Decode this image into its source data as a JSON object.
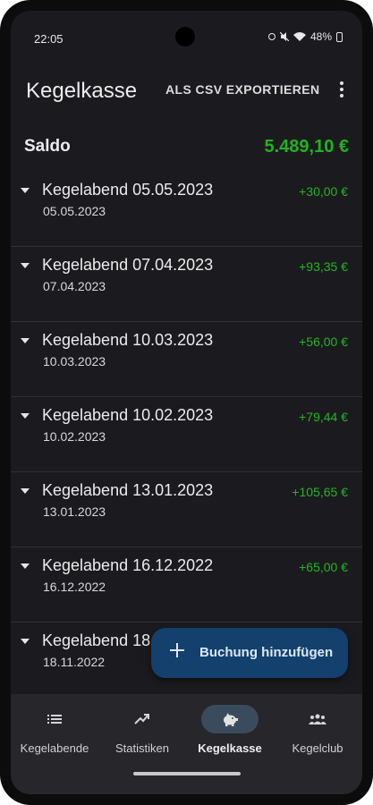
{
  "status_bar": {
    "time": "22:05",
    "battery": "48%"
  },
  "app_bar": {
    "title": "Kegelkasse",
    "export_label": "ALS CSV EXPORTIEREN",
    "more_icon": "more-vert-icon"
  },
  "balance": {
    "label": "Saldo",
    "value": "5.489,10 €"
  },
  "entries": [
    {
      "title": "Kegelabend 05.05.2023",
      "date": "05.05.2023",
      "amount": "+30,00 €"
    },
    {
      "title": "Kegelabend 07.04.2023",
      "date": "07.04.2023",
      "amount": "+93,35 €"
    },
    {
      "title": "Kegelabend 10.03.2023",
      "date": "10.03.2023",
      "amount": "+56,00 €"
    },
    {
      "title": "Kegelabend 10.02.2023",
      "date": "10.02.2023",
      "amount": "+79,44 €"
    },
    {
      "title": "Kegelabend 13.01.2023",
      "date": "13.01.2023",
      "amount": "+105,65 €"
    },
    {
      "title": "Kegelabend 16.12.2022",
      "date": "16.12.2022",
      "amount": "+65,00 €"
    },
    {
      "title": "Kegelabend 18.",
      "date": "18.11.2022",
      "amount": ""
    }
  ],
  "fab": {
    "label": "Buchung hinzufügen",
    "icon": "plus-icon"
  },
  "bottom_nav": [
    {
      "label": "Kegelabende",
      "icon": "list-icon",
      "active": false
    },
    {
      "label": "Statistiken",
      "icon": "trending-up-icon",
      "active": false
    },
    {
      "label": "Kegelkasse",
      "icon": "piggy-bank-icon",
      "active": true
    },
    {
      "label": "Kegelclub",
      "icon": "group-icon",
      "active": false
    }
  ],
  "colors": {
    "positive": "#23b523",
    "background": "#1b1b1f",
    "fab": "#13406c",
    "nav_active": "#3b4b5e"
  }
}
